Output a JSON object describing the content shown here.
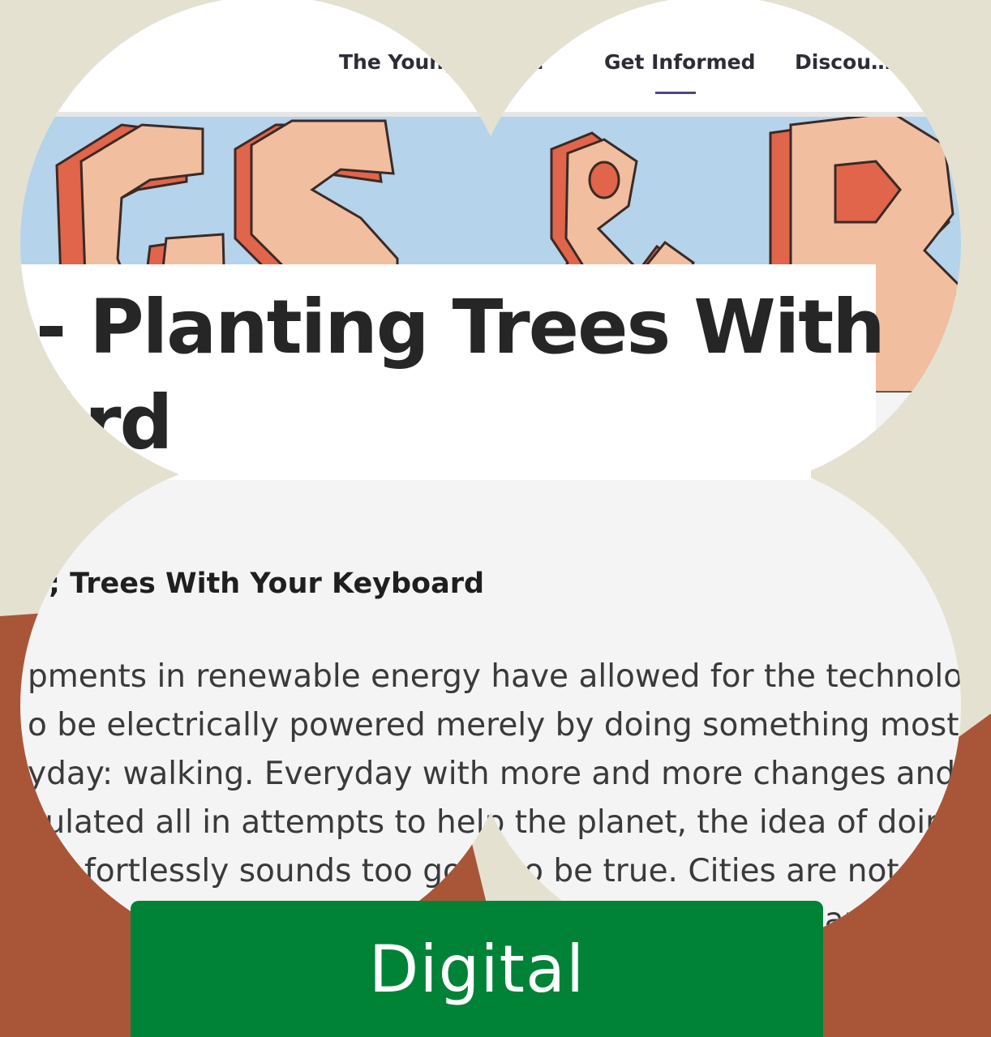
{
  "nav": {
    "items": [
      "The Young Sc… rd",
      "Get Informed",
      "Discou…"
    ],
    "active_index": 1
  },
  "title": {
    "line1": "- Planting Trees With",
    "line2": "ard"
  },
  "article": {
    "subheading": "; Trees With Your Keyboard",
    "paragraph_lines": [
      "pments in renewable energy have allowed for the technology f",
      "o be electrically powered merely by doing something most pec",
      "yday: walking. Everyday with more and more changes and ide",
      "culated all in attempts to help the planet, the idea of doing",
      "fortlessly sounds too good to be true. Cities are not ye",
      "s ar"
    ]
  },
  "label": {
    "text": "Digital"
  },
  "colors": {
    "page_background": "#e4e1d1",
    "rust": "#a85637",
    "banner_sky": "#b5d3ea",
    "banner_letter_fill": "#f2bea0",
    "banner_letter_shadow": "#e0654a",
    "label_green": "#008237",
    "nav_underline": "#4d4a7a"
  }
}
